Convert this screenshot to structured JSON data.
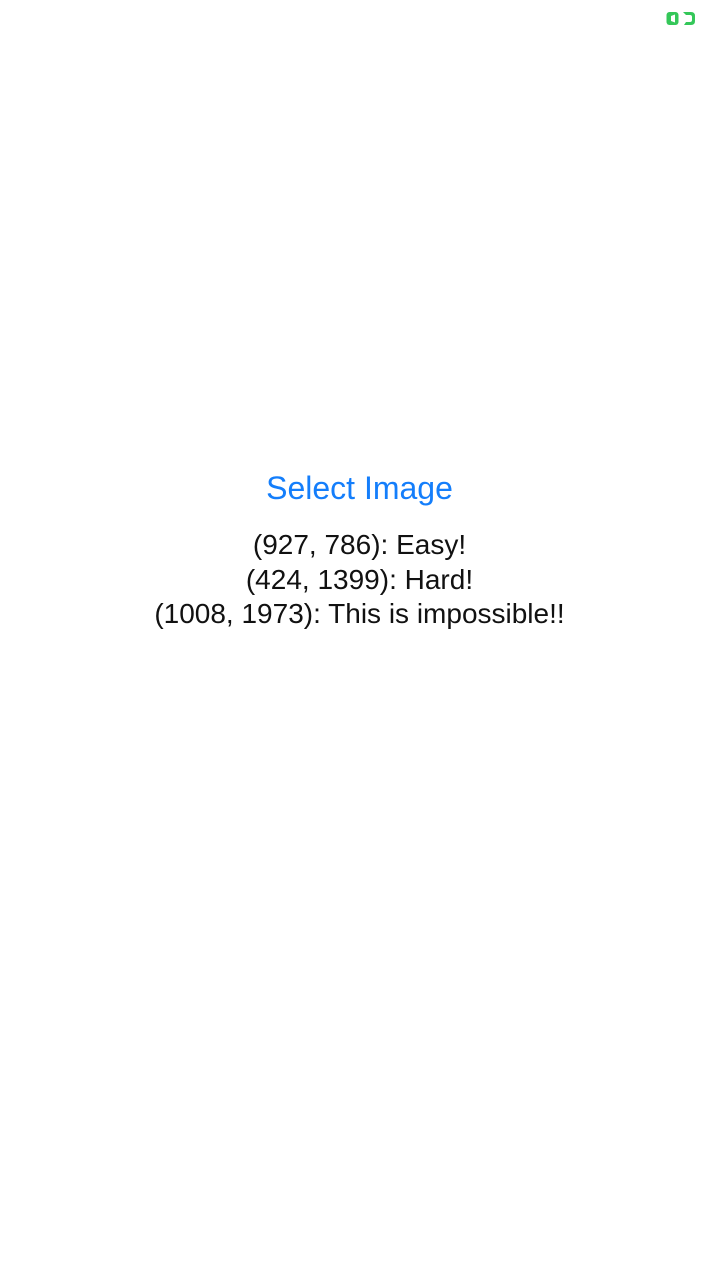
{
  "status_bar": {
    "indicator_icon": "screen-record-icon",
    "indicator_color": "#34c759"
  },
  "main": {
    "select_button_label": "Select Image",
    "accent_color": "#147efb",
    "results": [
      "(927, 786): Easy!",
      "(424, 1399): Hard!",
      "(1008, 1973): This is impossible!!"
    ]
  }
}
